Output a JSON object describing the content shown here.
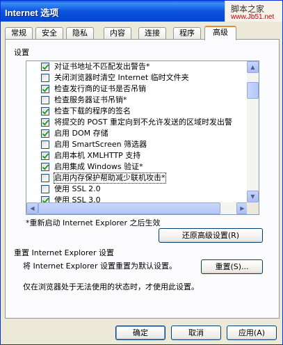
{
  "window": {
    "title": "Internet 选项"
  },
  "watermark": {
    "text": "脚本之家",
    "url": "www.Jb51.net"
  },
  "tabs": [
    {
      "label": "常规",
      "active": false
    },
    {
      "label": "安全",
      "active": false
    },
    {
      "label": "隐私",
      "active": false
    },
    {
      "label": "内容",
      "active": false
    },
    {
      "label": "连接",
      "active": false
    },
    {
      "label": "程序",
      "active": false
    },
    {
      "label": "高级",
      "active": true
    }
  ],
  "settings": {
    "group_label": "设置",
    "items": [
      {
        "label": "对证书地址不匹配发出警告*",
        "checked": true
      },
      {
        "label": "关闭浏览器时清空 Internet 临时文件夹",
        "checked": false
      },
      {
        "label": "检查发行商的证书是否吊销",
        "checked": true
      },
      {
        "label": "检查服务器证书吊销*",
        "checked": false
      },
      {
        "label": "检查下载的程序的签名",
        "checked": true
      },
      {
        "label": "将提交的 POST 重定向到不允许发送的区域时发出警",
        "checked": true
      },
      {
        "label": "启用 DOM 存储",
        "checked": true
      },
      {
        "label": "启用 SmartScreen 筛选器",
        "checked": false
      },
      {
        "label": "启用本机 XMLHTTP 支持",
        "checked": true
      },
      {
        "label": "启用集成 Windows 验证*",
        "checked": true
      },
      {
        "label": "启用内存保护帮助减少联机攻击*",
        "checked": false
      },
      {
        "label": "使用 SSL 2.0",
        "checked": false
      },
      {
        "label": "使用 SSL 3.0",
        "checked": true
      }
    ],
    "restart_note": "*重新启动 Internet Explorer 之后生效",
    "restore_button": "还原高级设置(R)"
  },
  "reset": {
    "heading": "重置 Internet Explorer 设置",
    "description": "将 Internet Explorer 设置重置为默认设置。",
    "button": "重置(S)...",
    "note": "仅在浏览器处于无法使用的状态时，才使用此设置。"
  },
  "footer": {
    "ok": "确定",
    "cancel": "取消",
    "apply": "应用(A)"
  }
}
